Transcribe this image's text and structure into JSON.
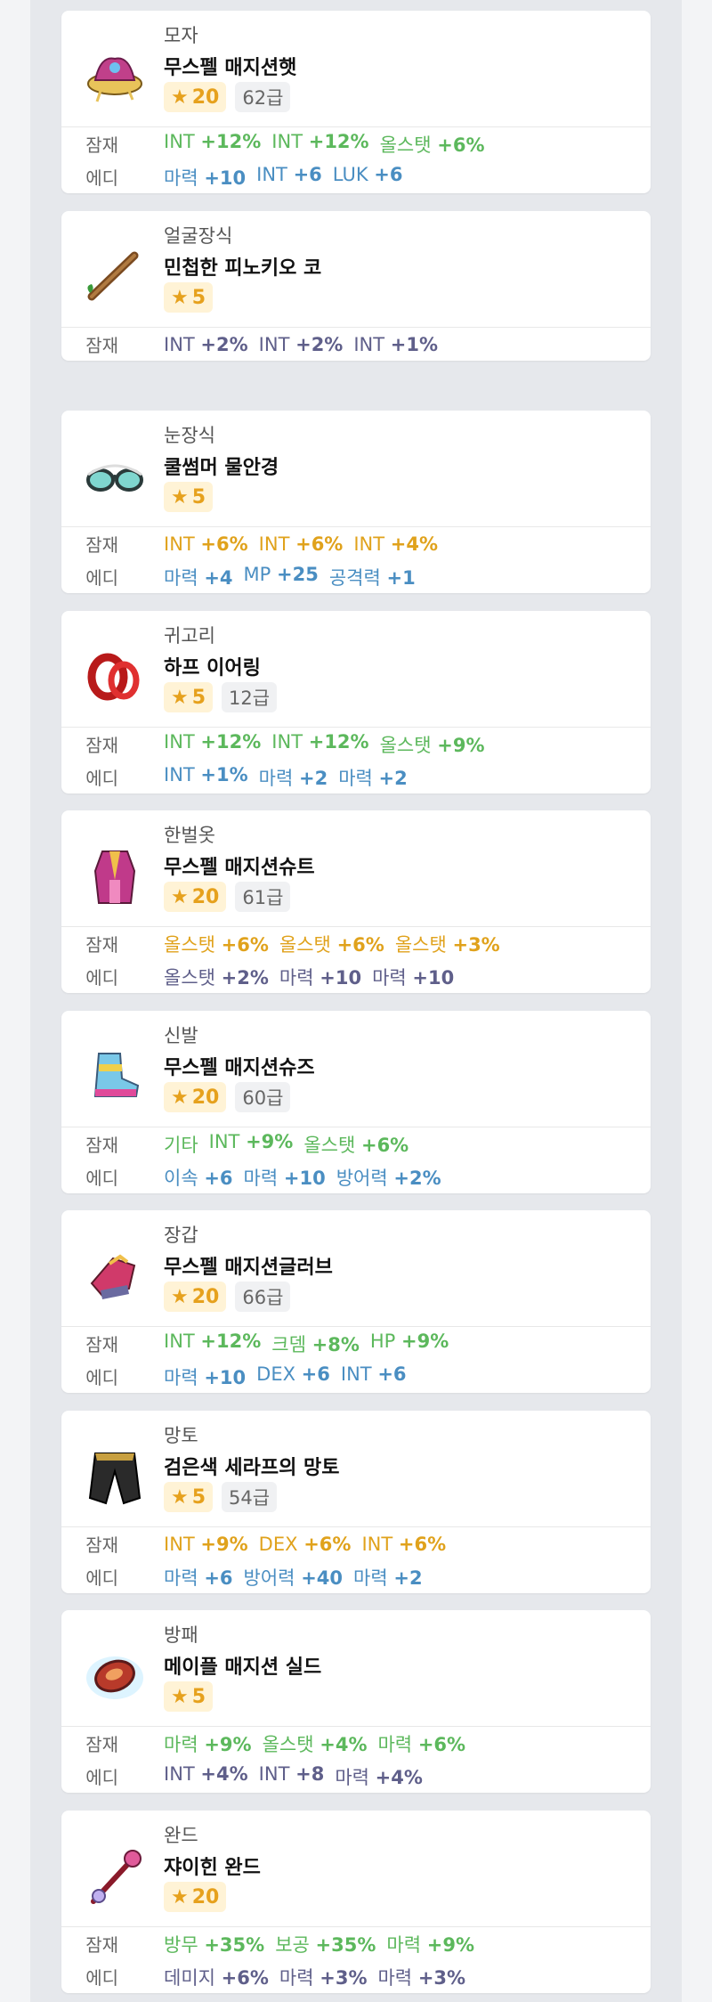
{
  "labels": {
    "potential": "잠재",
    "additional": "에디"
  },
  "items": [
    {
      "category": "모자",
      "name": "무스펠 매지션햇",
      "star": "20",
      "grade": "62급",
      "potential": [
        {
          "t": "INT",
          "v": "+12%",
          "c": "green"
        },
        {
          "t": "INT",
          "v": "+12%",
          "c": "green"
        },
        {
          "t": "올스탯",
          "v": "+6%",
          "c": "green"
        }
      ],
      "additional": [
        {
          "t": "마력",
          "v": "+10",
          "c": "blue"
        },
        {
          "t": "INT",
          "v": "+6",
          "c": "blue"
        },
        {
          "t": "LUK",
          "v": "+6",
          "c": "blue"
        }
      ],
      "icon": "hat-icon"
    },
    {
      "category": "얼굴장식",
      "name": "민첩한 피노키오 코",
      "star": "5",
      "grade": "",
      "potential": [
        {
          "t": "INT",
          "v": "+2%",
          "c": "purple"
        },
        {
          "t": "INT",
          "v": "+2%",
          "c": "purple"
        },
        {
          "t": "INT",
          "v": "+1%",
          "c": "purple"
        }
      ],
      "additional": [],
      "icon": "nose-icon"
    },
    {
      "category": "눈장식",
      "name": "쿨썸머 물안경",
      "star": "5",
      "grade": "",
      "potential": [
        {
          "t": "INT",
          "v": "+6%",
          "c": "gold"
        },
        {
          "t": "INT",
          "v": "+6%",
          "c": "gold"
        },
        {
          "t": "INT",
          "v": "+4%",
          "c": "gold"
        }
      ],
      "additional": [
        {
          "t": "마력",
          "v": "+4",
          "c": "blue"
        },
        {
          "t": "MP",
          "v": "+25",
          "c": "blue"
        },
        {
          "t": "공격력",
          "v": "+1",
          "c": "blue"
        }
      ],
      "icon": "goggles-icon"
    },
    {
      "category": "귀고리",
      "name": "하프 이어링",
      "star": "5",
      "grade": "12급",
      "potential": [
        {
          "t": "INT",
          "v": "+12%",
          "c": "green"
        },
        {
          "t": "INT",
          "v": "+12%",
          "c": "green"
        },
        {
          "t": "올스탯",
          "v": "+9%",
          "c": "green"
        }
      ],
      "additional": [
        {
          "t": "INT",
          "v": "+1%",
          "c": "blue"
        },
        {
          "t": "마력",
          "v": "+2",
          "c": "blue"
        },
        {
          "t": "마력",
          "v": "+2",
          "c": "blue"
        }
      ],
      "icon": "earring-icon"
    },
    {
      "category": "한벌옷",
      "name": "무스펠 매지션슈트",
      "star": "20",
      "grade": "61급",
      "potential": [
        {
          "t": "올스탯",
          "v": "+6%",
          "c": "gold"
        },
        {
          "t": "올스탯",
          "v": "+6%",
          "c": "gold"
        },
        {
          "t": "올스탯",
          "v": "+3%",
          "c": "gold"
        }
      ],
      "additional": [
        {
          "t": "올스탯",
          "v": "+2%",
          "c": "purple"
        },
        {
          "t": "마력",
          "v": "+10",
          "c": "purple"
        },
        {
          "t": "마력",
          "v": "+10",
          "c": "purple"
        }
      ],
      "icon": "suit-icon"
    },
    {
      "category": "신발",
      "name": "무스펠 매지션슈즈",
      "star": "20",
      "grade": "60급",
      "potential": [
        {
          "t": "기타",
          "v": "",
          "c": "green"
        },
        {
          "t": "INT",
          "v": "+9%",
          "c": "green"
        },
        {
          "t": "올스탯",
          "v": "+6%",
          "c": "green"
        }
      ],
      "additional": [
        {
          "t": "이속",
          "v": "+6",
          "c": "blue"
        },
        {
          "t": "마력",
          "v": "+10",
          "c": "blue"
        },
        {
          "t": "방어력",
          "v": "+2%",
          "c": "blue"
        }
      ],
      "icon": "shoes-icon"
    },
    {
      "category": "장갑",
      "name": "무스펠 매지션글러브",
      "star": "20",
      "grade": "66급",
      "potential": [
        {
          "t": "INT",
          "v": "+12%",
          "c": "green"
        },
        {
          "t": "크뎀",
          "v": "+8%",
          "c": "green"
        },
        {
          "t": "HP",
          "v": "+9%",
          "c": "green"
        }
      ],
      "additional": [
        {
          "t": "마력",
          "v": "+10",
          "c": "blue"
        },
        {
          "t": "DEX",
          "v": "+6",
          "c": "blue"
        },
        {
          "t": "INT",
          "v": "+6",
          "c": "blue"
        }
      ],
      "icon": "glove-icon"
    },
    {
      "category": "망토",
      "name": "검은색 세라프의 망토",
      "star": "5",
      "grade": "54급",
      "potential": [
        {
          "t": "INT",
          "v": "+9%",
          "c": "gold"
        },
        {
          "t": "DEX",
          "v": "+6%",
          "c": "gold"
        },
        {
          "t": "INT",
          "v": "+6%",
          "c": "gold"
        }
      ],
      "additional": [
        {
          "t": "마력",
          "v": "+6",
          "c": "blue"
        },
        {
          "t": "방어력",
          "v": "+40",
          "c": "blue"
        },
        {
          "t": "마력",
          "v": "+2",
          "c": "blue"
        }
      ],
      "icon": "cape-icon"
    },
    {
      "category": "방패",
      "name": "메이플 매지션 실드",
      "star": "5",
      "grade": "",
      "potential": [
        {
          "t": "마력",
          "v": "+9%",
          "c": "green"
        },
        {
          "t": "올스탯",
          "v": "+4%",
          "c": "green"
        },
        {
          "t": "마력",
          "v": "+6%",
          "c": "green"
        }
      ],
      "additional": [
        {
          "t": "INT",
          "v": "+4%",
          "c": "purple"
        },
        {
          "t": "INT",
          "v": "+8",
          "c": "purple"
        },
        {
          "t": "마력",
          "v": "+4%",
          "c": "purple"
        }
      ],
      "icon": "shield-icon"
    },
    {
      "category": "완드",
      "name": "쟈이힌 완드",
      "star": "20",
      "grade": "",
      "potential": [
        {
          "t": "방무",
          "v": "+35%",
          "c": "green"
        },
        {
          "t": "보공",
          "v": "+35%",
          "c": "green"
        },
        {
          "t": "마력",
          "v": "+9%",
          "c": "green"
        }
      ],
      "additional": [
        {
          "t": "데미지",
          "v": "+6%",
          "c": "purple"
        },
        {
          "t": "마력",
          "v": "+3%",
          "c": "purple"
        },
        {
          "t": "마력",
          "v": "+3%",
          "c": "purple"
        }
      ],
      "icon": "wand-icon"
    }
  ]
}
